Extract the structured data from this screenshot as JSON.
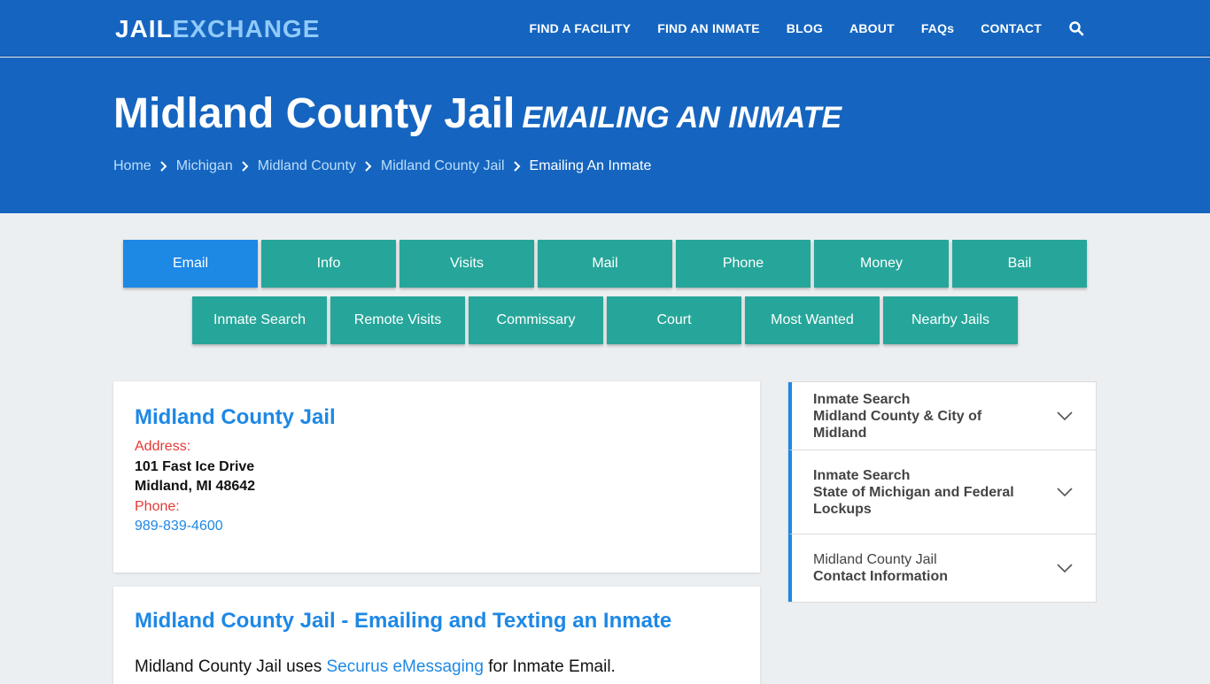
{
  "header": {
    "logo_part1": "JAIL",
    "logo_part2": "EXCHANGE",
    "nav": [
      "FIND A FACILITY",
      "FIND AN INMATE",
      "BLOG",
      "ABOUT",
      "FAQs",
      "CONTACT"
    ],
    "search_icon": "search-icon"
  },
  "hero": {
    "title": "Midland County Jail",
    "subtitle": "Emailing An Inmate",
    "breadcrumbs": [
      "Home",
      "Michigan",
      "Midland County",
      "Midland County Jail",
      "Emailing An Inmate"
    ]
  },
  "tabs": {
    "row1": [
      "Email",
      "Info",
      "Visits",
      "Mail",
      "Phone",
      "Money",
      "Bail"
    ],
    "row2": [
      "Inmate Search",
      "Remote Visits",
      "Commissary",
      "Court",
      "Most Wanted",
      "Nearby Jails"
    ],
    "active": "Email"
  },
  "facility_card": {
    "title": "Midland County Jail",
    "address_label": "Address:",
    "address_line1": "101 Fast Ice Drive",
    "address_line2": "Midland, MI 48642",
    "phone_label": "Phone:",
    "phone": "989-839-4600"
  },
  "email_card": {
    "title": "Midland County Jail - Emailing and Texting an Inmate",
    "text_before": "Midland County Jail uses ",
    "link": "Securus eMessaging",
    "text_after": " for Inmate Email."
  },
  "sidebar": {
    "items": [
      {
        "line1": "Inmate Search",
        "line2": "Midland County & City of Midland"
      },
      {
        "line1": "Inmate Search",
        "line2": "State of Michigan and Federal Lockups"
      },
      {
        "line1": "Midland County Jail",
        "line2": "Contact Information"
      }
    ]
  },
  "colors": {
    "brand_blue": "#1565c0",
    "accent_blue": "#1e88e5",
    "tab_teal": "#26a69a",
    "label_red": "#e53935"
  }
}
